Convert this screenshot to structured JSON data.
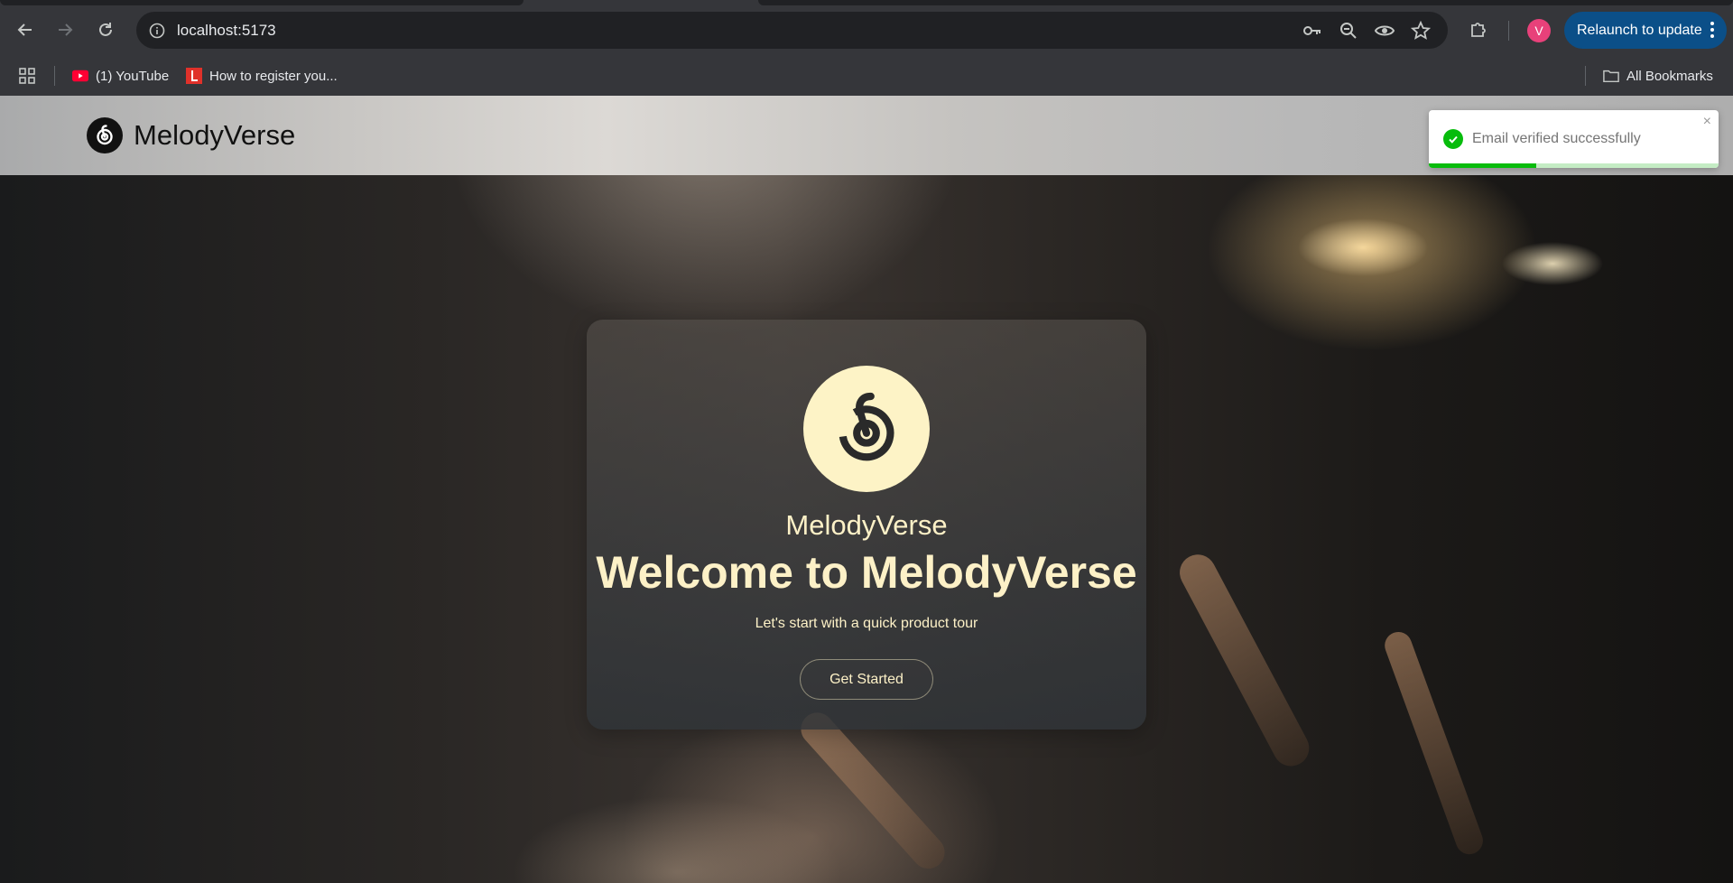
{
  "browser": {
    "url": "localhost:5173",
    "relaunch_label": "Relaunch to update",
    "profile_initial": "V",
    "bookmarks": [
      {
        "label": "(1) YouTube",
        "icon": "youtube-icon"
      },
      {
        "label": "How to register you...",
        "icon": "l-favicon-icon"
      }
    ],
    "all_bookmarks_label": "All Bookmarks"
  },
  "header": {
    "brand": "MelodyVerse"
  },
  "toast": {
    "message": "Email verified successfully",
    "close_glyph": "×",
    "progress_fraction": 0.37,
    "colors": {
      "success": "#07bc0c"
    }
  },
  "hero": {
    "brand": "MelodyVerse",
    "title": "Welcome to MelodyVerse",
    "subtitle": "Let's start with a quick product tour",
    "cta_label": "Get Started",
    "colors": {
      "accent": "#fdf1c7"
    }
  }
}
